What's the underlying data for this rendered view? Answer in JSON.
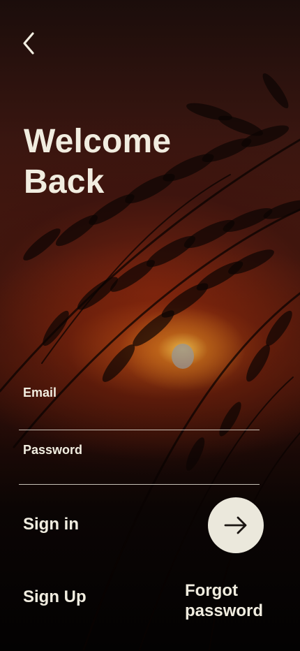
{
  "header": {
    "back_icon": "chevron-left-icon",
    "title_line1": "Welcome",
    "title_line2": "Back"
  },
  "form": {
    "email_label": "Email",
    "email_value": "",
    "password_label": "Password",
    "password_value": ""
  },
  "actions": {
    "sign_in_label": "Sign in",
    "sign_in_icon": "arrow-right-icon",
    "sign_up_label": "Sign Up",
    "forgot_password_line1": "Forgot",
    "forgot_password_line2": "password"
  },
  "colors": {
    "text": "#f1ede0",
    "button_bg": "#ebe8dc",
    "background_top": "#1b0d0b",
    "background_bottom": "#030202"
  }
}
